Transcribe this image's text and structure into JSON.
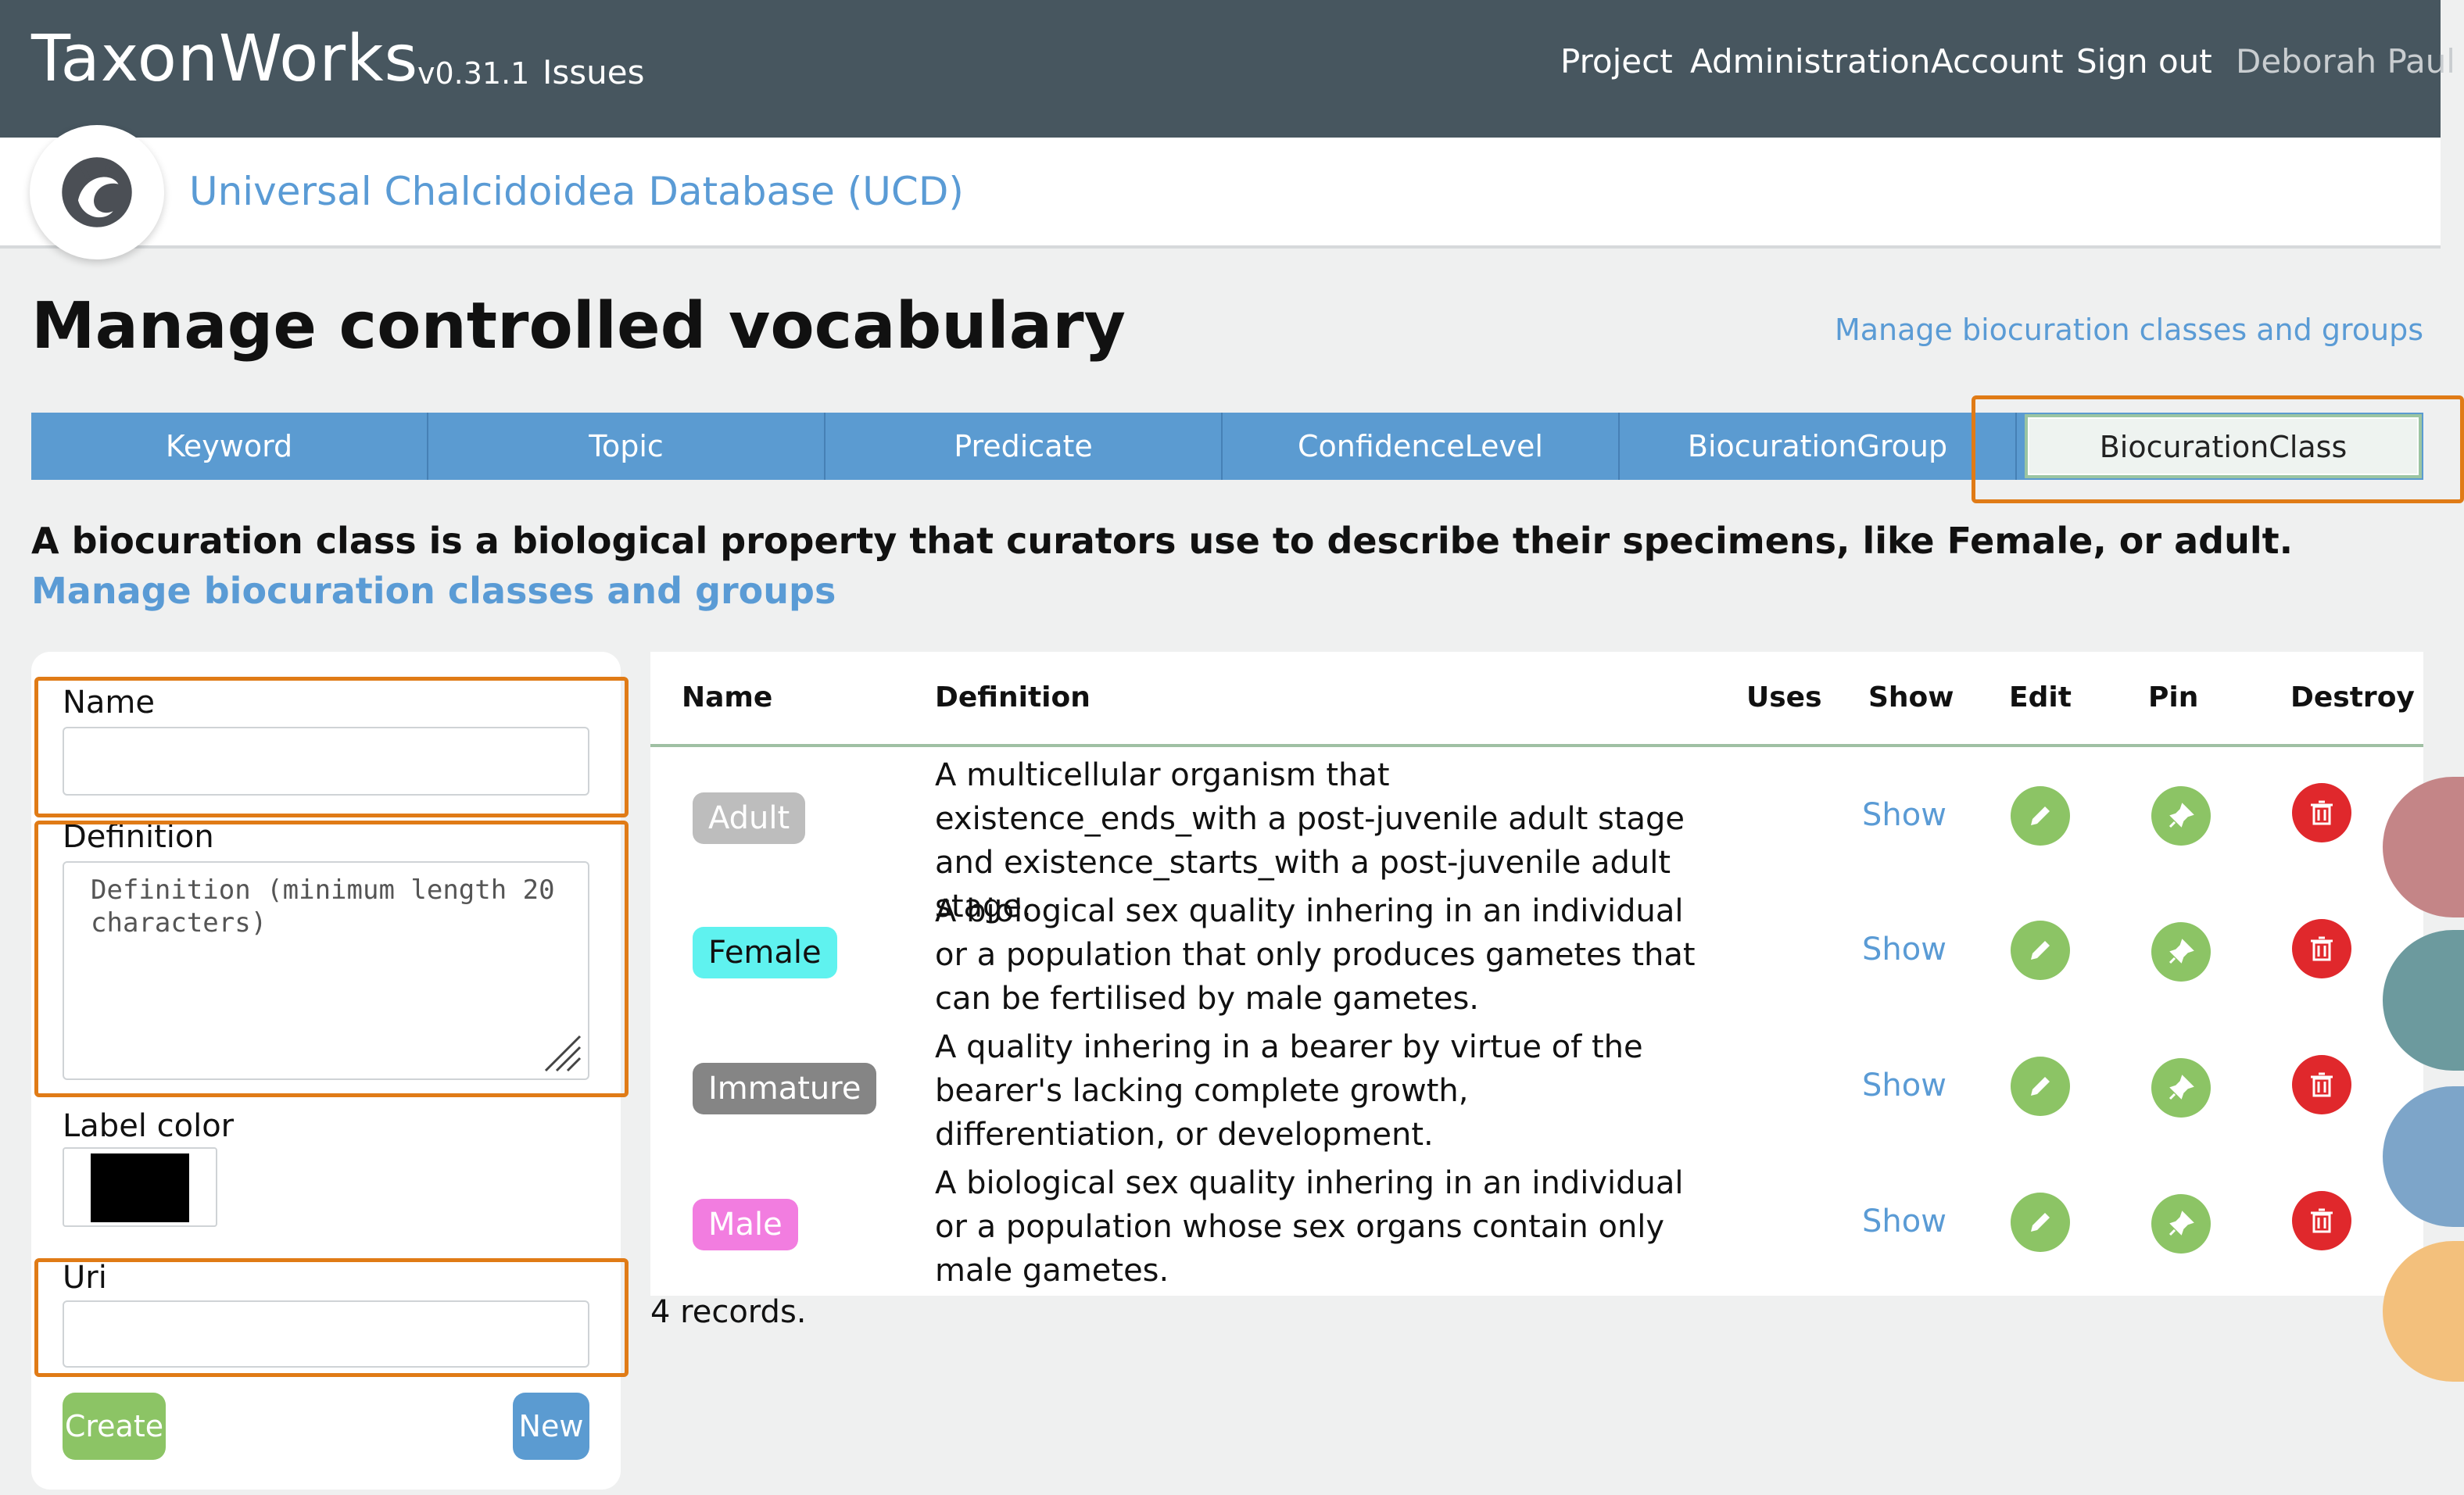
{
  "header": {
    "brand": "TaxonWorks",
    "version": "v0.31.1",
    "issues": "Issues",
    "nav": [
      "Project",
      "Administration",
      "Account",
      "Sign out"
    ],
    "user": "Deborah Paul"
  },
  "project": {
    "name": "Universal Chalcidoidea Database (UCD)"
  },
  "page": {
    "title": "Manage controlled vocabulary",
    "manage_link": "Manage biocuration classes and groups"
  },
  "tabs": [
    "Keyword",
    "Topic",
    "Predicate",
    "ConfidenceLevel",
    "BiocurationGroup",
    "BiocurationClass"
  ],
  "active_tab": "BiocurationClass",
  "description": {
    "text": "A biocuration class is a biological property that curators use to describe their specimens, like Female, or adult.",
    "link_text": "Manage biocuration classes and groups"
  },
  "form": {
    "name_label": "Name",
    "name_value": "",
    "definition_label": "Definition",
    "definition_placeholder": "Definition (minimum length 20 characters)",
    "label_color_label": "Label color",
    "label_color_value": "#000000",
    "uri_label": "Uri",
    "uri_value": "",
    "create_button": "Create",
    "new_button": "New"
  },
  "table": {
    "headers": [
      "Name",
      "Definition",
      "Uses",
      "Show",
      "Edit",
      "Pin",
      "Destroy"
    ],
    "rows": [
      {
        "name": "Adult",
        "color": "#bdbdbd",
        "text_color": "#ffffff",
        "definition": "A multicellular organism that existence_ends_with a post-juvenile adult stage and existence_starts_with a post-juvenile adult stage.",
        "uses": "",
        "show": "Show"
      },
      {
        "name": "Female",
        "color": "#5ff2ef",
        "text_color": "#111111",
        "definition": "A biological sex quality inhering in an individual or a population that only produces gametes that can be fertilised by male gametes.",
        "uses": "",
        "show": "Show"
      },
      {
        "name": "Immature",
        "color": "#858585",
        "text_color": "#ffffff",
        "definition": "A quality inhering in a bearer by virtue of the bearer's lacking complete growth, differentiation, or development.",
        "uses": "",
        "show": "Show"
      },
      {
        "name": "Male",
        "color": "#f27de0",
        "text_color": "#ffffff",
        "definition": "A biological sex quality inhering in an individual or a population whose sex organs contain only male gametes.",
        "uses": "",
        "show": "Show"
      }
    ],
    "records": "4 records."
  },
  "colors": {
    "topbar": "#47565f",
    "link": "#5a9bd5",
    "tab": "#5b9bd1",
    "highlight": "#e07b16",
    "edit": "#8cc465",
    "destroy": "#e0282c"
  },
  "icons": [
    "pencil-icon",
    "pin-icon",
    "trash-icon",
    "project-logo-icon"
  ]
}
